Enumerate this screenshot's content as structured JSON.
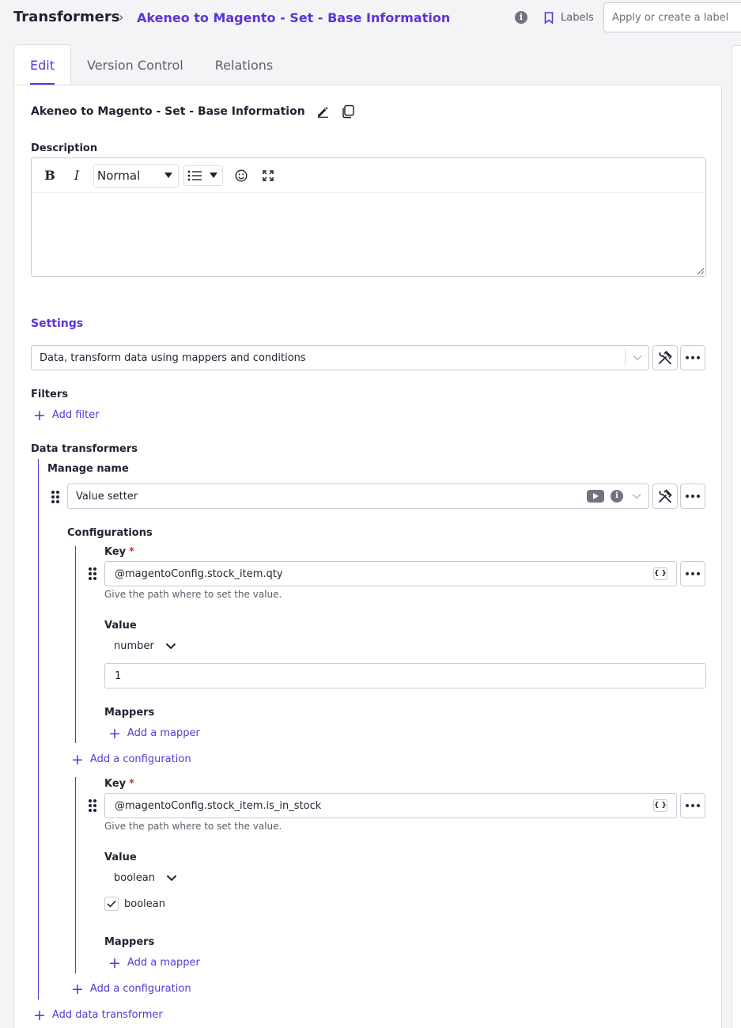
{
  "breadcrumb": {
    "root": "Transformers",
    "separator": "›",
    "current": "Akeneo to Magento - Set - Base Information"
  },
  "header": {
    "labels_button": "Labels",
    "label_input_placeholder": "Apply or create a label"
  },
  "tabs": [
    {
      "label": "Edit",
      "active": true
    },
    {
      "label": "Version Control",
      "active": false
    },
    {
      "label": "Relations",
      "active": false
    }
  ],
  "main": {
    "title": "Akeneo to Magento - Set - Base Information",
    "description_label": "Description",
    "editor": {
      "bold_label": "B",
      "italic_label": "I",
      "style_select": "Normal",
      "body_text": ""
    },
    "settings_title": "Settings",
    "settings_select": "Data, transform data using mappers and conditions",
    "filters_label": "Filters",
    "add_filter": "Add filter",
    "data_transformers_label": "Data transformers",
    "add_data_transformer": "Add data transformer",
    "transformer": {
      "name": "Manage name",
      "type": "Value setter",
      "configurations_label": "Configurations",
      "configurations": [
        {
          "key_label": "Key",
          "required_mark": "*",
          "key_value": "@magentoConfig.stock_item.qty",
          "key_hint": "Give the path where to set the value.",
          "value_label": "Value",
          "value_type": "number",
          "value": "1",
          "mappers_label": "Mappers",
          "add_mapper": "Add a mapper",
          "add_configuration": "Add a configuration"
        },
        {
          "key_label": "Key",
          "required_mark": "*",
          "key_value": "@magentoConfig.stock_item.is_in_stock",
          "key_hint": "Give the path where to set the value.",
          "value_label": "Value",
          "value_type": "boolean",
          "checkbox_label": "boolean",
          "checked": true,
          "mappers_label": "Mappers",
          "add_mapper": "Add a mapper",
          "add_configuration": "Add a configuration"
        }
      ]
    }
  },
  "colors": {
    "accent": "#5b35d5",
    "text": "#1f2433",
    "muted": "#5b5f6b",
    "border": "#c9cbd3",
    "required": "#d93025"
  },
  "icons": [
    "info-icon",
    "bookmark-icon",
    "pencil-icon",
    "copy-icon",
    "list-icon",
    "emoji-icon",
    "expand-icon",
    "chevron-down-icon",
    "tools-icon",
    "more-icon",
    "drag-handle-icon",
    "youtube-icon",
    "braces-icon",
    "plus-icon",
    "check-icon"
  ]
}
